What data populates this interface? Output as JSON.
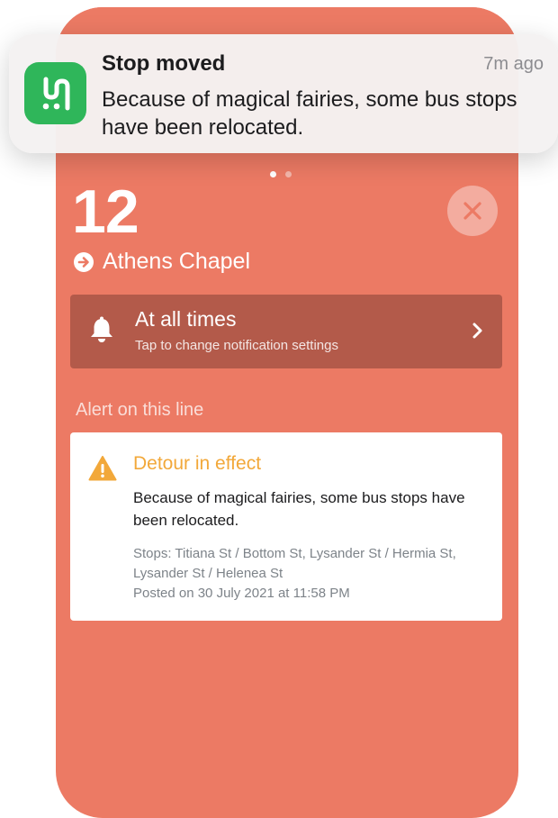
{
  "notification": {
    "app_icon": "transit-app-icon",
    "title": "Stop moved",
    "time": "7m ago",
    "body": "Because of magical fairies, some bus stops have been relocated."
  },
  "route": {
    "number": "12",
    "destination": "Athens Chapel",
    "color": "#ec7a64"
  },
  "settings_bar": {
    "title": "At all times",
    "subtitle": "Tap to change notification settings"
  },
  "alerts": {
    "heading": "Alert on this line",
    "items": [
      {
        "title": "Detour in effect",
        "body": "Because of magical fairies, some bus stops have been relocated.",
        "stops": "Stops: Titiana St / Bottom St, Lysander St / Hermia St, Lysander St / Helenea St",
        "posted": "Posted on 30 July 2021 at 11:58 PM"
      }
    ]
  },
  "pager": {
    "pages": 2,
    "current": 1
  }
}
